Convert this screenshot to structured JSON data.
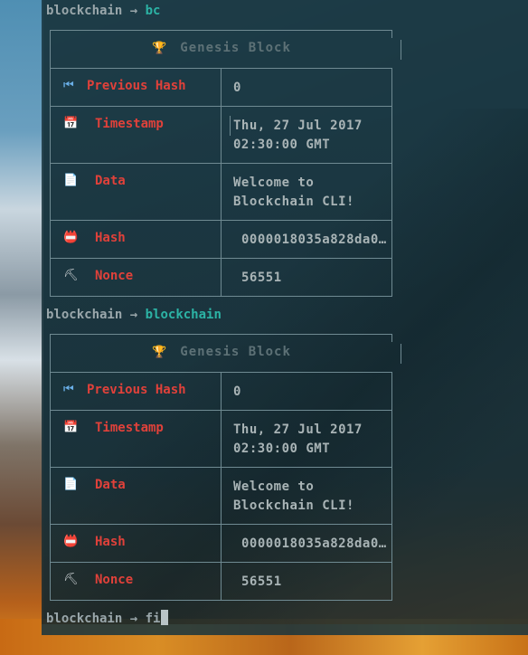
{
  "prompt_user": "blockchain",
  "prompt_arrow": "→",
  "commands": [
    "bc",
    "blockchain"
  ],
  "current_input": "fi",
  "blocks": [
    {
      "title": "Genesis Block",
      "rows": [
        {
          "key": "Previous Hash",
          "icon": "rewind-icon",
          "value": "0"
        },
        {
          "key": "Timestamp",
          "icon": "calendar-icon",
          "value": "Thu, 27 Jul 2017\n02:30:00 GMT"
        },
        {
          "key": "Data",
          "icon": "document-icon",
          "value": "Welcome to\nBlockchain CLI!"
        },
        {
          "key": "Hash",
          "icon": "hash-icon",
          "value": "0000018035a828da0…"
        },
        {
          "key": "Nonce",
          "icon": "pickaxe-icon",
          "value": "56551"
        }
      ]
    },
    {
      "title": "Genesis Block",
      "rows": [
        {
          "key": "Previous Hash",
          "icon": "rewind-icon",
          "value": "0"
        },
        {
          "key": "Timestamp",
          "icon": "calendar-icon",
          "value": "Thu, 27 Jul 2017\n02:30:00 GMT"
        },
        {
          "key": "Data",
          "icon": "document-icon",
          "value": "Welcome to\nBlockchain CLI!"
        },
        {
          "key": "Hash",
          "icon": "hash-icon",
          "value": "0000018035a828da0…"
        },
        {
          "key": "Nonce",
          "icon": "pickaxe-icon",
          "value": "56551"
        }
      ]
    }
  ],
  "colors": {
    "command": "#2cb3a5",
    "key": "#e0413a",
    "text": "#9aa7ab",
    "trophy": "#e9b53a"
  }
}
